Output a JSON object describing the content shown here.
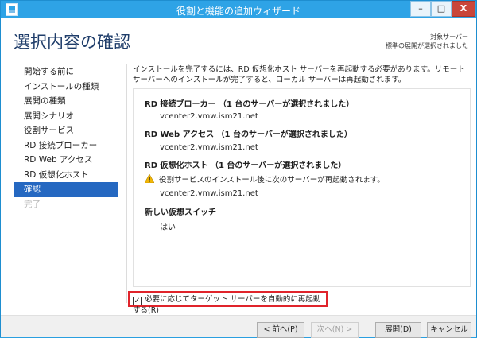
{
  "window": {
    "title": "役割と機能の追加ウィザード",
    "minimize": "–",
    "maximize": "□",
    "close": "X"
  },
  "header": {
    "page_title": "選択内容の確認",
    "target_label": "対象サーバー",
    "target_value": "標準の展開が選択されました"
  },
  "nav": {
    "items": [
      {
        "label": "開始する前に",
        "state": "normal"
      },
      {
        "label": "インストールの種類",
        "state": "normal"
      },
      {
        "label": "展開の種類",
        "state": "normal"
      },
      {
        "label": "展開シナリオ",
        "state": "normal"
      },
      {
        "label": "役割サービス",
        "state": "normal"
      },
      {
        "label": "RD 接続ブローカー",
        "state": "normal"
      },
      {
        "label": "RD Web アクセス",
        "state": "normal"
      },
      {
        "label": "RD 仮想化ホスト",
        "state": "normal"
      },
      {
        "label": "確認",
        "state": "active"
      },
      {
        "label": "完了",
        "state": "disabled"
      }
    ]
  },
  "main": {
    "intro": "インストールを完了するには、RD 仮想化ホスト サーバーを再起動する必要があります。リモート サーバーへのインストールが完了すると、ローカル サーバーは再起動されます。",
    "summary": {
      "broker_heading": "RD 接続ブローカー （1 台のサーバーが選択されました）",
      "broker_server": "vcenter2.vmw.ism21.net",
      "web_heading": "RD Web アクセス （1 台のサーバーが選択されました）",
      "web_server": "vcenter2.vmw.ism21.net",
      "host_heading": "RD 仮想化ホスト （1 台のサーバーが選択されました）",
      "host_warning": "役割サービスのインストール後に次のサーバーが再起動されます。",
      "host_server": "vcenter2.vmw.ism21.net",
      "switch_heading": "新しい仮想スイッチ",
      "switch_value": "はい"
    },
    "restart_checkbox": {
      "label": "必要に応じてターゲット サーバーを自動的に再起動する(R)",
      "checked": true,
      "mark": "✓"
    }
  },
  "footer": {
    "prev": "< 前へ(P)",
    "next": "次へ(N) >",
    "deploy": "展開(D)",
    "cancel": "キャンセル"
  },
  "colors": {
    "titlebar": "#2ea3e6",
    "nav_active": "#2568c1",
    "highlight_border": "#e0242b",
    "warning": "#f2b705"
  }
}
